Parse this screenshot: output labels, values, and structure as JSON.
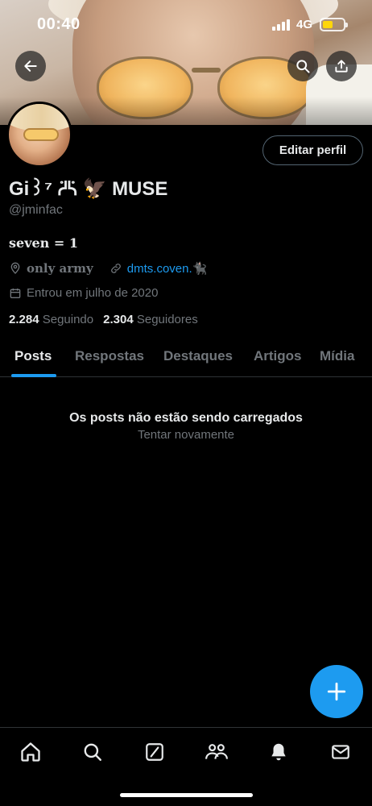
{
  "status_bar": {
    "time": "00:40",
    "network": "4G",
    "battery_color": "#ffd60a"
  },
  "header": {
    "back_icon": "arrow-left-icon",
    "search_icon": "search-icon",
    "share_icon": "share-icon"
  },
  "profile": {
    "edit_label": "Editar perfil",
    "display_name": "Gi꒱⁷ ᢾᢿ 🦅 MUSE",
    "handle": "@jminfac",
    "bio": "seven = 1",
    "location": "only army",
    "link": "dmts.coven.🐈‍⬛",
    "joined": "Entrou em julho de 2020",
    "following_count": "2.284",
    "following_label": "Seguindo",
    "followers_count": "2.304",
    "followers_label": "Seguidores"
  },
  "tabs": [
    {
      "label": "Posts",
      "active": true
    },
    {
      "label": "Respostas",
      "active": false
    },
    {
      "label": "Destaques",
      "active": false
    },
    {
      "label": "Artigos",
      "active": false
    },
    {
      "label": "Mídia",
      "active": false
    }
  ],
  "feed": {
    "empty_title": "Os posts não estão sendo carregados",
    "retry_label": "Tentar novamente"
  },
  "fab": {
    "icon": "plus-icon",
    "color": "#1d9bf0"
  },
  "bottom_nav": [
    {
      "icon": "home-icon"
    },
    {
      "icon": "search-icon"
    },
    {
      "icon": "grok-icon"
    },
    {
      "icon": "communities-icon"
    },
    {
      "icon": "bell-icon"
    },
    {
      "icon": "mail-icon"
    }
  ],
  "colors": {
    "accent": "#1d9bf0",
    "secondary_text": "#71767b",
    "background": "#000000"
  }
}
